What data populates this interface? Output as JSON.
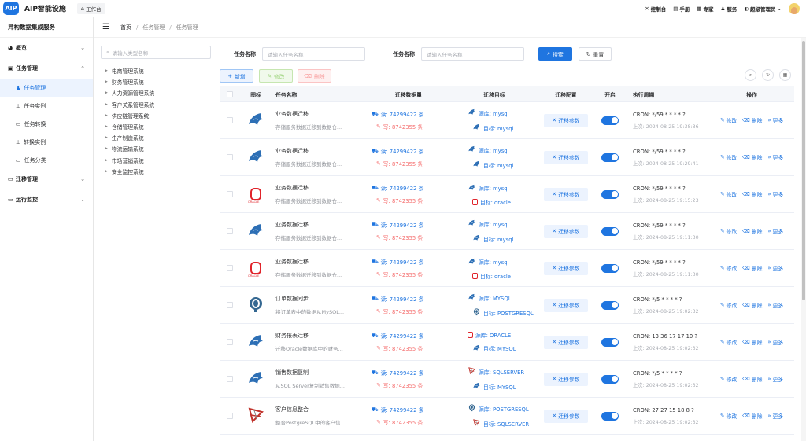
{
  "app": {
    "logo": "AIP",
    "title": "AIP智能设施",
    "workbench": "工作台"
  },
  "topbar": {
    "items": [
      {
        "label": "控制台",
        "icon": "tools-icon"
      },
      {
        "label": "手册",
        "icon": "book-icon"
      },
      {
        "label": "专家",
        "icon": "expert-icon"
      },
      {
        "label": "服务",
        "icon": "users-icon"
      },
      {
        "label": "超级管理员",
        "icon": "shield-icon"
      }
    ]
  },
  "sidebar": {
    "subtitle": "异构数据集成服务",
    "overview": "概览",
    "task_mgmt": "任务管理",
    "items": [
      "任务管理",
      "任务实例",
      "任务转换",
      "转换实例",
      "任务分类"
    ],
    "migration": "迁移管理",
    "ops": "运行监控"
  },
  "breadcrumb": {
    "home": "首页",
    "level1": "任务管理",
    "level2": "任务管理"
  },
  "tree": {
    "placeholder": "请输入类型名称",
    "nodes": [
      "电商管理系统",
      "财务管理系统",
      "人力资源管理系统",
      "客户关系管理系统",
      "供应链管理系统",
      "仓储管理系统",
      "生产制造系统",
      "物流运输系统",
      "市场营销系统",
      "安全监控系统"
    ]
  },
  "search": {
    "label1": "任务名称",
    "placeholder1": "请输入任务名称",
    "label2": "任务名称",
    "placeholder2": "请输入任务名称",
    "search_btn": "搜索",
    "reset_btn": "重置"
  },
  "toolbar": {
    "add": "新增",
    "edit": "修改",
    "delete": "删除"
  },
  "table": {
    "headers": {
      "icon": "图标",
      "name": "任务名称",
      "volume": "迁移数据量",
      "target": "迁移目标",
      "config": "迁移配置",
      "enabled": "开启",
      "cron": "执行周期",
      "ops": "操作"
    },
    "cfg_label": "迁移参数",
    "op_edit": "修改",
    "op_delete": "删除",
    "op_more": "更多",
    "rows": [
      {
        "icon": "mysql",
        "name": "业务数据迁移",
        "desc": "存储服务数据迁移到数据仓...",
        "read": "读: 74299422 条",
        "write": "写: 8742355 条",
        "src_icon": "mysql",
        "src": "源库: mysql",
        "dst_icon": "mysql",
        "dst": "目标: mysql",
        "cron": "CRON: */59 * * * * ?",
        "last": "上次: 2024-08-25 19:38:36"
      },
      {
        "icon": "mysql",
        "name": "业务数据迁移",
        "desc": "存储服务数据迁移到数据仓...",
        "read": "读: 74299422 条",
        "write": "写: 8742355 条",
        "src_icon": "mysql",
        "src": "源库: mysql",
        "dst_icon": "mysql",
        "dst": "目标: mysql",
        "cron": "CRON: */59 * * * * ?",
        "last": "上次: 2024-08-25 19:29:41"
      },
      {
        "icon": "oracle",
        "name": "业务数据迁移",
        "desc": "存储服务数据迁移到数据仓...",
        "read": "读: 74299422 条",
        "write": "写: 8742355 条",
        "src_icon": "mysql",
        "src": "源库: mysql",
        "dst_icon": "oracle",
        "dst": "目标: oracle",
        "cron": "CRON: */59 * * * * ?",
        "last": "上次: 2024-08-25 19:15:23"
      },
      {
        "icon": "mysql",
        "name": "业务数据迁移",
        "desc": "存储服务数据迁移到数据仓...",
        "read": "读: 74299422 条",
        "write": "写: 8742355 条",
        "src_icon": "mysql",
        "src": "源库: mysql",
        "dst_icon": "mysql",
        "dst": "目标: mysql",
        "cron": "CRON: */59 * * * * ?",
        "last": "上次: 2024-08-25 19:11:30"
      },
      {
        "icon": "oracle",
        "name": "业务数据迁移",
        "desc": "存储服务数据迁移到数据仓...",
        "read": "读: 74299422 条",
        "write": "写: 8742355 条",
        "src_icon": "mysql",
        "src": "源库: mysql",
        "dst_icon": "oracle",
        "dst": "目标: oracle",
        "cron": "CRON: */59 * * * * ?",
        "last": "上次: 2024-08-25 19:11:30"
      },
      {
        "icon": "postgres",
        "name": "订单数据同步",
        "desc": "将订单表中的数据从MySQL...",
        "read": "读: 74299422 条",
        "write": "写: 8742355 条",
        "src_icon": "mysql",
        "src": "源库: MYSQL",
        "dst_icon": "postgres",
        "dst": "目标: POSTGRESQL",
        "cron": "CRON: */5 * * * * ?",
        "last": "上次: 2024-08-25 19:02:32"
      },
      {
        "icon": "mysql",
        "name": "财务报表迁移",
        "desc": "迁移Oracle数据库中的财务...",
        "read": "读: 74299422 条",
        "write": "写: 8742355 条",
        "src_icon": "oracle",
        "src": "源库: ORACLE",
        "dst_icon": "mysql",
        "dst": "目标: MYSQL",
        "cron": "CRON: 13 36 17 17 10 ?",
        "last": "上次: 2024-08-25 19:02:32"
      },
      {
        "icon": "mysql",
        "name": "销售数据复制",
        "desc": "从SQL Server复制销售数据...",
        "read": "读: 74299422 条",
        "write": "写: 8742355 条",
        "src_icon": "sqlserver",
        "src": "源库: SQLSERVER",
        "dst_icon": "mysql",
        "dst": "目标: MYSQL",
        "cron": "CRON: */5 * * * * ?",
        "last": "上次: 2024-08-25 19:02:32"
      },
      {
        "icon": "sqlserver",
        "name": "客户信息整合",
        "desc": "整合PostgreSQL中的客户信...",
        "read": "读: 74299422 条",
        "write": "写: 8742355 条",
        "src_icon": "postgres",
        "src": "源库: POSTGRESQL",
        "dst_icon": "sqlserver",
        "dst": "目标: SQLSERVER",
        "cron": "CRON: 27 27 15 18 8 ?",
        "last": "上次: 2024-08-25 19:02:32"
      }
    ]
  },
  "colors": {
    "primary": "#1f75e0",
    "danger": "#f56c6c",
    "oracle": "#e0242b"
  }
}
